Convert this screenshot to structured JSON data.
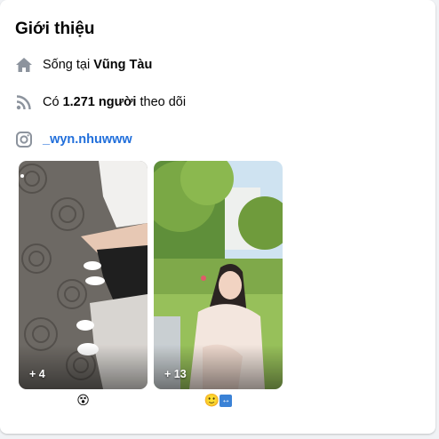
{
  "intro": {
    "title": "Giới thiệu",
    "live": {
      "prefix": "Sống tại ",
      "place": "Vũng Tàu",
      "icon": "home-icon"
    },
    "followers": {
      "prefix": "Có ",
      "count": "1.271 người",
      "suffix": " theo dõi",
      "icon": "rss-icon"
    },
    "instagram": {
      "handle": "_wyn.nhuwww",
      "icon": "instagram-icon"
    }
  },
  "featured": [
    {
      "count_label": "+ 4",
      "caption": "😵"
    },
    {
      "count_label": "+ 13",
      "caption": "🙂",
      "caption_box": "↔"
    }
  ],
  "colors": {
    "link": "#216fdb",
    "icon_gray": "#8c939d",
    "accent_box": "#3b82d6"
  }
}
